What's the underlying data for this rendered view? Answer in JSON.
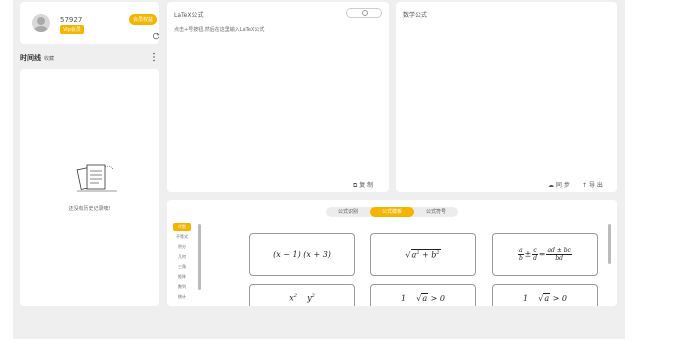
{
  "user": {
    "uid": "57927",
    "vip_badge": "Vip会员",
    "member_button": "会员权益"
  },
  "timeline": {
    "title": "时间线",
    "favorite": "收藏",
    "empty_text": "还没有历史记录噢!"
  },
  "latex": {
    "title": "LaTeX公式",
    "hint": "点击+号按钮,然后在这里输入LaTeX公式",
    "copy_label": "复 制"
  },
  "math": {
    "title": "数学公式",
    "sync_label": "同 步",
    "export_label": "导 出"
  },
  "formula_tabs": [
    {
      "label": "公式识别",
      "active": false
    },
    {
      "label": "公式模板",
      "active": true
    },
    {
      "label": "公式符号",
      "active": false
    }
  ],
  "categories": [
    "代数",
    "不等式",
    "积分",
    "几何",
    "三角",
    "矩阵",
    "数列",
    "统计"
  ],
  "templates": [
    {
      "name": "template-product",
      "latex": "(x-1)(x+3)"
    },
    {
      "name": "template-sqrt-sum-squares",
      "latex": "\\sqrt{a^2+b^2}"
    },
    {
      "name": "template-fraction-sum",
      "latex": "\\frac{a}{b}\\pm\\frac{c}{d}=\\frac{ad\\pm bc}{bd}"
    }
  ]
}
